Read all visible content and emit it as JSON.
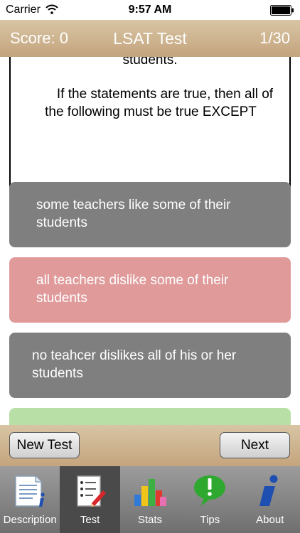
{
  "status_bar": {
    "carrier": "Carrier",
    "time": "9:57 AM"
  },
  "header": {
    "score": "Score: 0",
    "title": "LSAT Test",
    "progress": "1/30"
  },
  "question": {
    "tail": "students.",
    "prompt": "If the statements are true, then all of the following must be true EXCEPT"
  },
  "answers": [
    {
      "text": "some teachers like some of their students"
    },
    {
      "text": "all teachers dislike some of their students"
    },
    {
      "text": "no teahcer dislikes all of his or her students"
    },
    {
      "text": ""
    }
  ],
  "actions": {
    "new_test": "New Test",
    "next": "Next"
  },
  "tabs": [
    {
      "label": "Description",
      "icon": "description-icon"
    },
    {
      "label": "Test",
      "icon": "test-icon",
      "active": true
    },
    {
      "label": "Stats",
      "icon": "stats-icon"
    },
    {
      "label": "Tips",
      "icon": "tips-icon"
    },
    {
      "label": "About",
      "icon": "about-icon"
    }
  ],
  "colors": {
    "header": "#c9ad87",
    "answer_neutral": "#7f7f7f",
    "answer_wrong": "#e09a9a",
    "answer_correct": "#b8e0a6"
  }
}
